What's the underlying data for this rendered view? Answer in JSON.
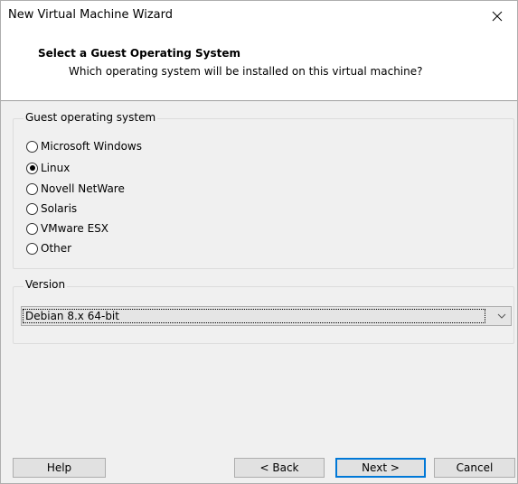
{
  "window": {
    "title": "New Virtual Machine Wizard",
    "close_icon": "close-icon"
  },
  "header": {
    "title": "Select a Guest Operating System",
    "subtitle": "Which operating system will be installed on this virtual machine?"
  },
  "guest_os": {
    "legend": "Guest operating system",
    "options": [
      {
        "label": "Microsoft Windows",
        "checked": false
      },
      {
        "label": "Linux",
        "checked": true
      },
      {
        "label": "Novell NetWare",
        "checked": false
      },
      {
        "label": "Solaris",
        "checked": false
      },
      {
        "label": "VMware ESX",
        "checked": false
      },
      {
        "label": "Other",
        "checked": false
      }
    ]
  },
  "version": {
    "legend": "Version",
    "selected": "Debian 8.x 64-bit",
    "arrow_icon": "chevron-down-icon"
  },
  "buttons": {
    "help": "Help",
    "back": "< Back",
    "next": "Next >",
    "cancel": "Cancel"
  }
}
